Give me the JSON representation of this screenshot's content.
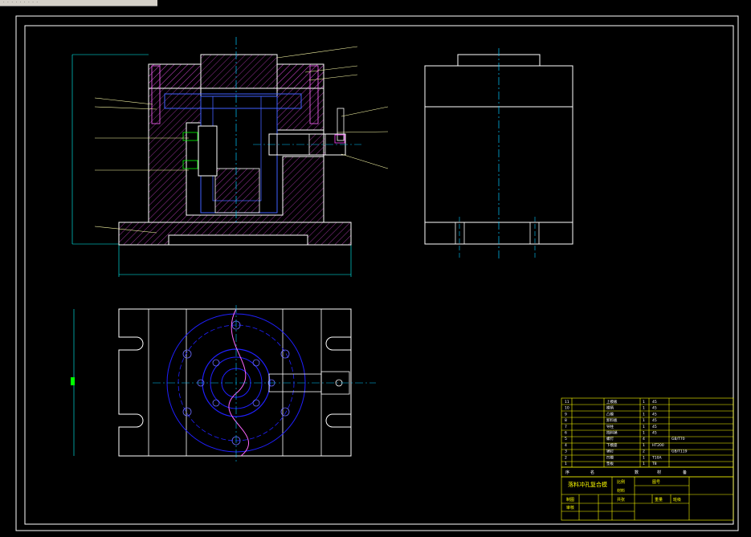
{
  "window": {
    "tab_text": "· · · · · · · · ·"
  },
  "colors": {
    "background": "#000000",
    "frame": "#ffffff",
    "hatch": "#c040c0",
    "center_line": "#00c8ff",
    "leader": "#ffffaa",
    "bolt": "#00ff00",
    "circle": "#2020ff",
    "table_line": "#ffff00",
    "dimension": "#00ffff"
  },
  "title_block": {
    "parts": [
      {
        "no": "11",
        "name": "上模板",
        "qty": "1",
        "mat": "45",
        "note": ""
      },
      {
        "no": "10",
        "name": "模柄",
        "qty": "1",
        "mat": "45",
        "note": ""
      },
      {
        "no": "9",
        "name": "凸模",
        "qty": "1",
        "mat": "45",
        "note": ""
      },
      {
        "no": "8",
        "name": "卸料板",
        "qty": "1",
        "mat": "45",
        "note": ""
      },
      {
        "no": "7",
        "name": "导柱",
        "qty": "1",
        "mat": "45",
        "note": ""
      },
      {
        "no": "6",
        "name": "挡料销",
        "qty": "1",
        "mat": "45",
        "note": ""
      },
      {
        "no": "5",
        "name": "螺钉",
        "qty": "4",
        "mat": "",
        "note": "GB/T70"
      },
      {
        "no": "4",
        "name": "下模座",
        "qty": "1",
        "mat": "HT200",
        "note": ""
      },
      {
        "no": "3",
        "name": "销钉",
        "qty": "2",
        "mat": "",
        "note": "GB/T119"
      },
      {
        "no": "2",
        "name": "凹模",
        "qty": "1",
        "mat": "T10A",
        "note": ""
      },
      {
        "no": "1",
        "name": "垫板",
        "qty": "1",
        "mat": "T8",
        "note": ""
      }
    ],
    "header": {
      "no": "序",
      "name": "名",
      "qty": "数",
      "mat": "材",
      "note": "备"
    },
    "drawing_title": "落料冲孔复合模",
    "labels": {
      "ratio": "比例",
      "sheet": "图号",
      "drawn": "制图",
      "checked": "审核",
      "scale": "重量",
      "count": "共张",
      "material": "材料",
      "school": "班级"
    }
  }
}
